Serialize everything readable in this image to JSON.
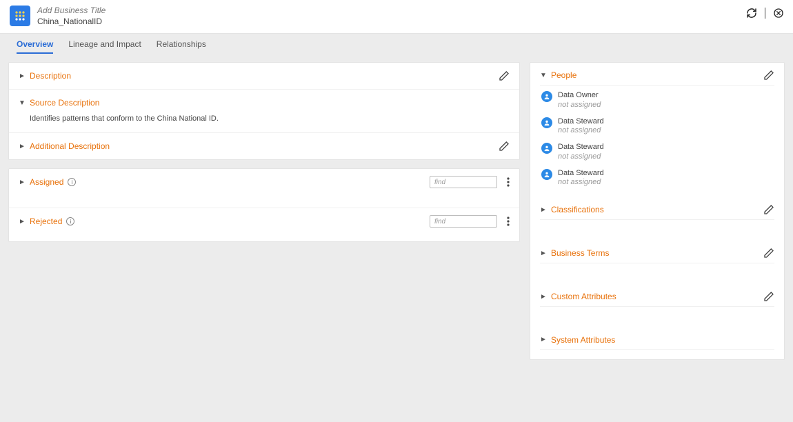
{
  "header": {
    "add_title_placeholder": "Add Business Title",
    "object_name": "China_NationalID"
  },
  "tabs": [
    {
      "id": "overview",
      "label": "Overview",
      "active": true
    },
    {
      "id": "lineage",
      "label": "Lineage and Impact",
      "active": false
    },
    {
      "id": "relationships",
      "label": "Relationships",
      "active": false
    }
  ],
  "left": {
    "top_sections": [
      {
        "id": "description",
        "title": "Description",
        "expanded": false,
        "editable": true
      },
      {
        "id": "source_description",
        "title": "Source Description",
        "expanded": true,
        "body": "Identifies patterns that conform to the China National ID.",
        "editable": false
      },
      {
        "id": "additional_description",
        "title": "Additional Description",
        "expanded": false,
        "editable": true
      }
    ],
    "bottom_sections": [
      {
        "id": "assigned",
        "title": "Assigned",
        "info": true,
        "find_placeholder": "find"
      },
      {
        "id": "rejected",
        "title": "Rejected",
        "info": true,
        "find_placeholder": "find"
      }
    ]
  },
  "right": {
    "people": {
      "title": "People",
      "expanded": true,
      "roles": [
        {
          "role": "Data Owner",
          "status": "not assigned"
        },
        {
          "role": "Data Steward",
          "status": "not assigned"
        },
        {
          "role": "Data Steward",
          "status": "not assigned"
        },
        {
          "role": "Data Steward",
          "status": "not assigned"
        }
      ]
    },
    "sections": [
      {
        "id": "classifications",
        "title": "Classifications",
        "editable": true
      },
      {
        "id": "business_terms",
        "title": "Business Terms",
        "editable": true
      },
      {
        "id": "custom_attributes",
        "title": "Custom Attributes",
        "editable": true
      },
      {
        "id": "system_attributes",
        "title": "System Attributes",
        "editable": false
      }
    ]
  }
}
